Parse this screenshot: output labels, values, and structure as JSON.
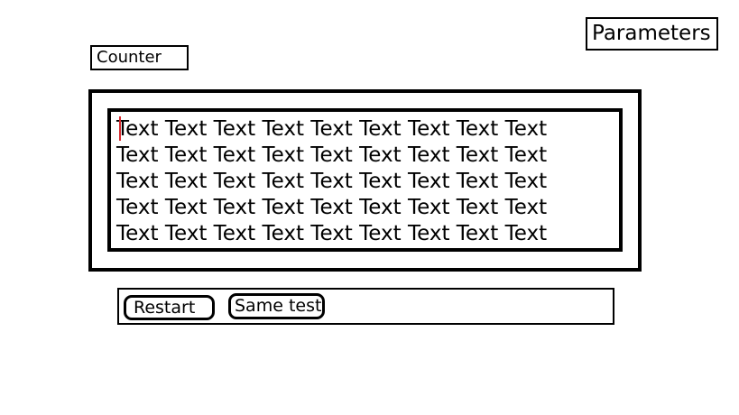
{
  "header": {
    "parameters_label": "Parameters"
  },
  "counter": {
    "label": "Counter"
  },
  "typing_area": {
    "lines": [
      "Text Text Text Text Text Text Text Text Text",
      "Text Text Text Text Text Text Text Text Text",
      "Text Text Text Text Text Text Text Text Text",
      "Text Text Text Text Text Text Text Text Text",
      "Text Text Text Text Text Text Text Text Text"
    ],
    "caret_color": "#d8292f"
  },
  "controls": {
    "restart_label": "Restart",
    "same_test_label": "Same test"
  }
}
